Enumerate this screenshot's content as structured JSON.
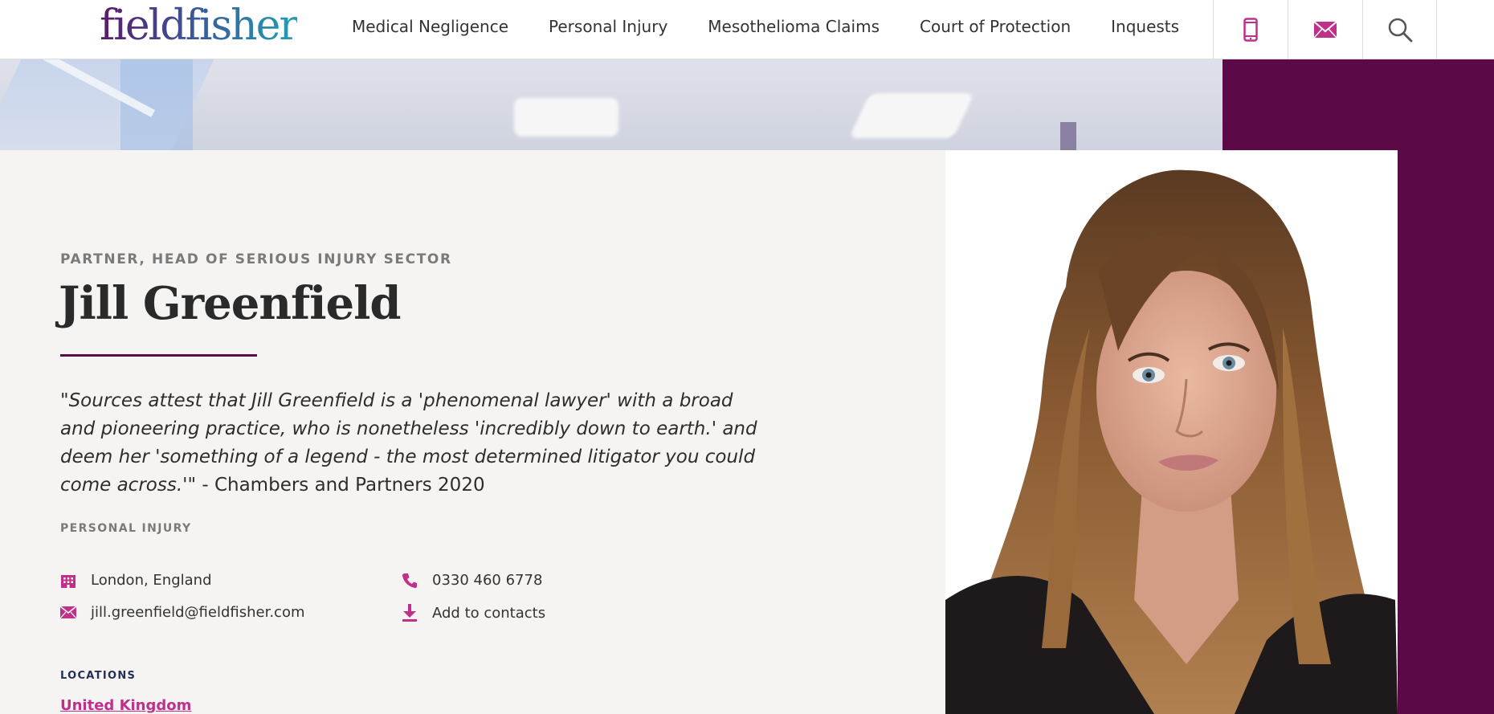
{
  "header": {
    "logo_text": "fieldfisher",
    "nav": [
      {
        "label": "Medical Negligence"
      },
      {
        "label": "Personal Injury"
      },
      {
        "label": "Mesothelioma Claims"
      },
      {
        "label": "Court of Protection"
      },
      {
        "label": "Inquests"
      }
    ],
    "actions": [
      {
        "icon": "mobile-phone-icon"
      },
      {
        "icon": "envelope-icon"
      },
      {
        "icon": "search-icon"
      }
    ],
    "icon_color": "#c0308a"
  },
  "profile": {
    "role": "PARTNER, HEAD OF SERIOUS INJURY SECTOR",
    "name": "Jill Greenfield",
    "quote": "\"Sources attest that Jill Greenfield is a 'phenomenal lawyer' with a broad and pioneering practice, who is nonetheless 'incredibly down to earth.' and deem her 'something of a legend - the most determined litigator you could come across.'\"",
    "quote_source": " - Chambers and Partners 2020",
    "practice": "PERSONAL INJURY",
    "contacts": {
      "location": "London, England",
      "phone": "0330 460 6778",
      "email": "jill.greenfield@fieldfisher.com",
      "add_contacts": "Add to contacts"
    },
    "locations_label": "LOCATIONS",
    "location_link": "United Kingdom"
  },
  "colors": {
    "brand_purple": "#5c0a47",
    "accent_pink": "#c0308a",
    "panel_bg": "#f5f4f2"
  }
}
